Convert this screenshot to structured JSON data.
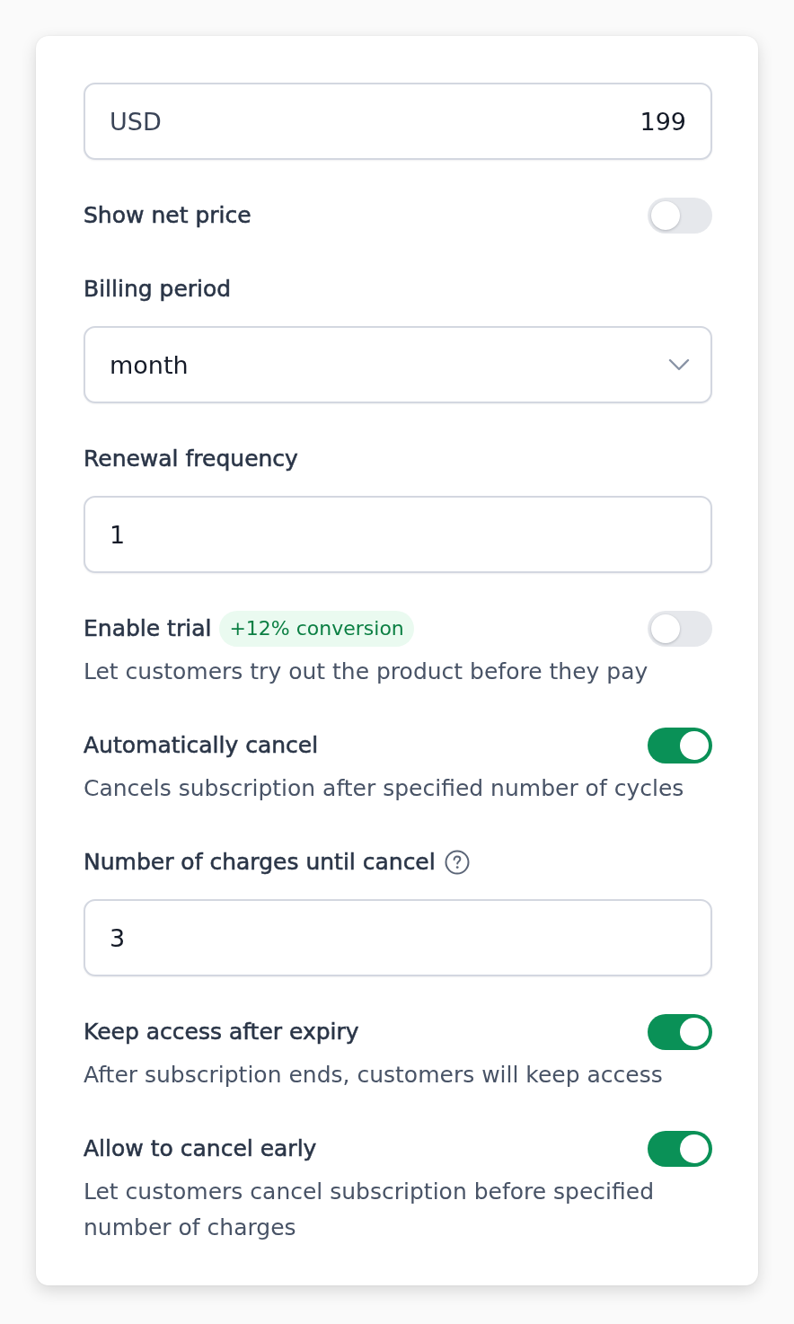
{
  "price": {
    "currency": "USD",
    "amount": "199"
  },
  "settings": [
    {
      "kind": "toggle",
      "label": "Show net price",
      "on": false
    },
    {
      "kind": "select",
      "label": "Billing period",
      "value": "month"
    },
    {
      "kind": "number",
      "label": "Renewal frequency",
      "value": "1"
    },
    {
      "kind": "toggle",
      "label": "Enable trial",
      "badge": "+12% conversion",
      "description": "Let customers try out the product before they pay",
      "on": false
    },
    {
      "kind": "toggle",
      "label": "Automatically cancel",
      "description": "Cancels subscription after specified number of cycles",
      "on": true
    },
    {
      "kind": "number",
      "label": "Number of charges until cancel",
      "help": true,
      "value": "3"
    },
    {
      "kind": "toggle",
      "label": "Keep access after expiry",
      "description": "After subscription ends, customers will keep access",
      "on": true
    },
    {
      "kind": "toggle",
      "label": "Allow to cancel early",
      "description": "Let customers cancel subscription before specified number of charges",
      "on": true
    }
  ]
}
